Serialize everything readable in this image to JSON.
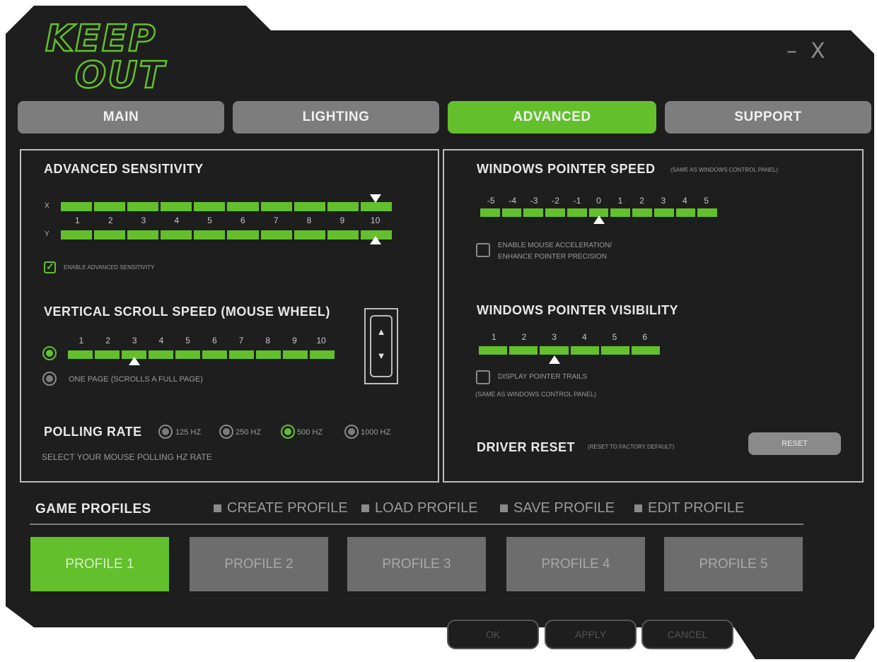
{
  "app": {
    "logo_text": [
      "KEEP",
      "OUT"
    ],
    "window_controls": {
      "minimize": "–",
      "close": "X"
    }
  },
  "tabs": [
    {
      "label": "MAIN",
      "active": false
    },
    {
      "label": "LIGHTING",
      "active": false
    },
    {
      "label": "ADVANCED",
      "active": true
    },
    {
      "label": "SUPPORT",
      "active": false
    }
  ],
  "advanced_sensitivity": {
    "title": "ADVANCED SENSITIVITY",
    "x_label": "X",
    "y_label": "Y",
    "scale": [
      "1",
      "2",
      "3",
      "4",
      "5",
      "6",
      "7",
      "8",
      "9",
      "10"
    ],
    "x_value": 10,
    "y_value": 10,
    "checkbox_label": "ENABLE ADVANCED SENSITIVITY",
    "checkbox_checked": true,
    "checkmark": "✓"
  },
  "scroll_speed": {
    "title": "VERTICAL SCROLL SPEED (MOUSE WHEEL)",
    "scale": [
      "1",
      "2",
      "3",
      "4",
      "5",
      "6",
      "7",
      "8",
      "9",
      "10"
    ],
    "value": 3,
    "option_page_label": "ONE PAGE (SCROLLS A FULL PAGE)",
    "selected": "lines",
    "wheel_up": "▲",
    "wheel_down": "▼"
  },
  "polling_rate": {
    "title": "POLLING RATE",
    "options": [
      "125 HZ",
      "250 HZ",
      "500 HZ",
      "1000 HZ"
    ],
    "selected": "500 HZ",
    "hint": "SELECT YOUR MOUSE POLLING HZ RATE"
  },
  "pointer_speed": {
    "title": "WINDOWS POINTER SPEED",
    "note": "(SAME AS WINDOWS CONTROL PANEL)",
    "scale": [
      "-5",
      "-4",
      "-3",
      "-2",
      "-1",
      "0",
      "1",
      "2",
      "3",
      "4",
      "5"
    ],
    "value": "0",
    "checkbox_label_1": "ENABLE MOUSE ACCELERATION/",
    "checkbox_label_2": "ENHANCE POINTER PRECISION",
    "checkbox_checked": false
  },
  "pointer_visibility": {
    "title": "WINDOWS POINTER VISIBILITY",
    "scale": [
      "1",
      "2",
      "3",
      "4",
      "5",
      "6"
    ],
    "value": 3,
    "checkbox_label": "DISPLAY POINTER TRAILS",
    "checkbox_checked": false,
    "note": "(SAME AS WINDOWS CONTROL PANEL)"
  },
  "driver_reset": {
    "title": "DRIVER RESET",
    "note": "(RESET TO FACTORY DEFAULT)",
    "button": "RESET"
  },
  "game_profiles": {
    "title": "GAME PROFILES",
    "actions": [
      "CREATE PROFILE",
      "LOAD PROFILE",
      "SAVE PROFILE",
      "EDIT PROFILE"
    ],
    "profiles": [
      {
        "label": "PROFILE 1",
        "active": true
      },
      {
        "label": "PROFILE 2",
        "active": false
      },
      {
        "label": "PROFILE 3",
        "active": false
      },
      {
        "label": "PROFILE 4",
        "active": false
      },
      {
        "label": "PROFILE 5",
        "active": false
      }
    ]
  },
  "footer_buttons": [
    "OK",
    "APPLY",
    "CANCEL"
  ],
  "colors": {
    "accent": "#63c02c",
    "background": "#1e1e1e",
    "inactive": "#7d7d7d"
  }
}
